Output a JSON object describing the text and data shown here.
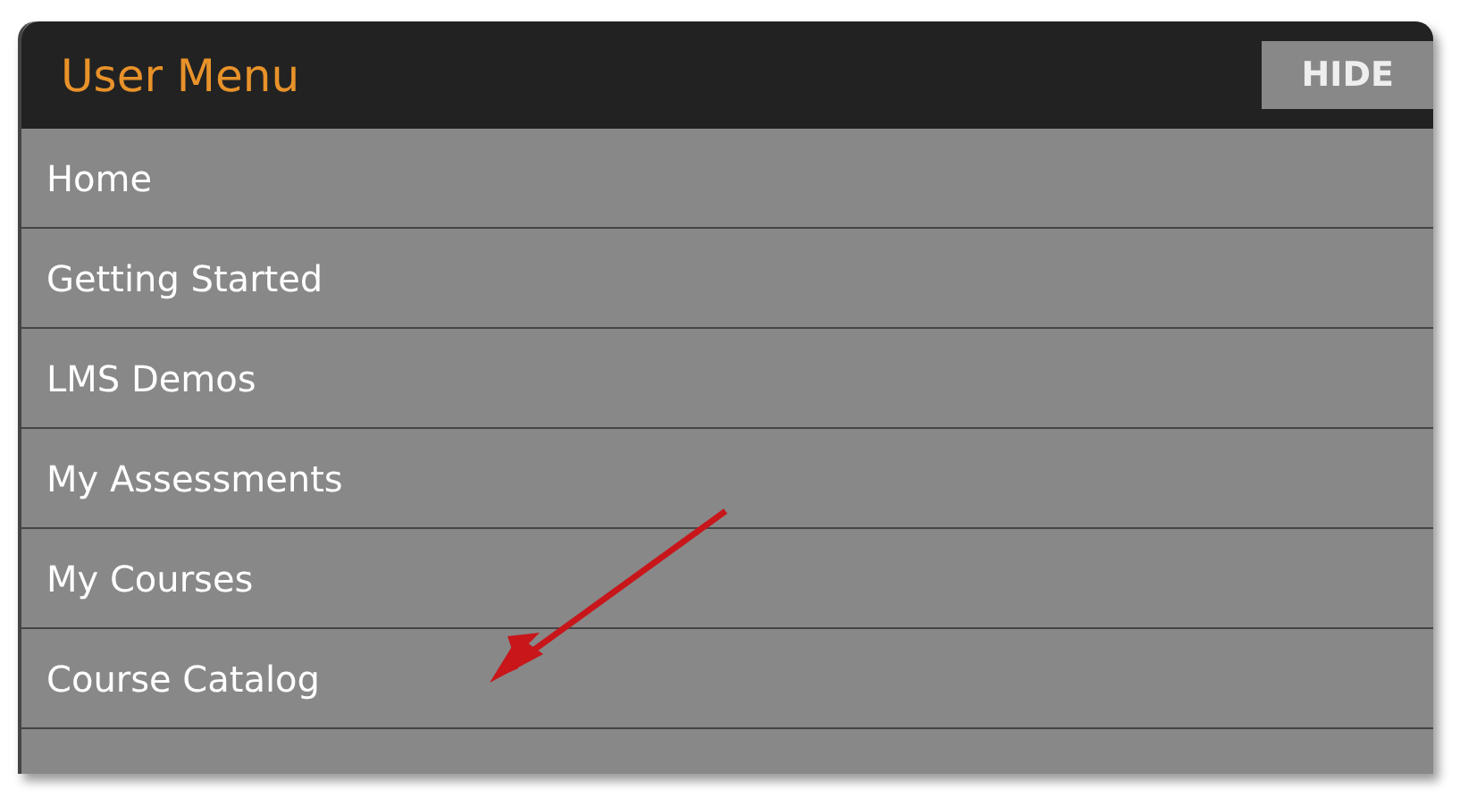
{
  "panel": {
    "title": "User Menu",
    "hide_button": "HIDE"
  },
  "items": [
    {
      "label": "Home"
    },
    {
      "label": "Getting Started"
    },
    {
      "label": "LMS Demos"
    },
    {
      "label": "My Assessments"
    },
    {
      "label": "My Courses"
    },
    {
      "label": "Course Catalog"
    }
  ]
}
